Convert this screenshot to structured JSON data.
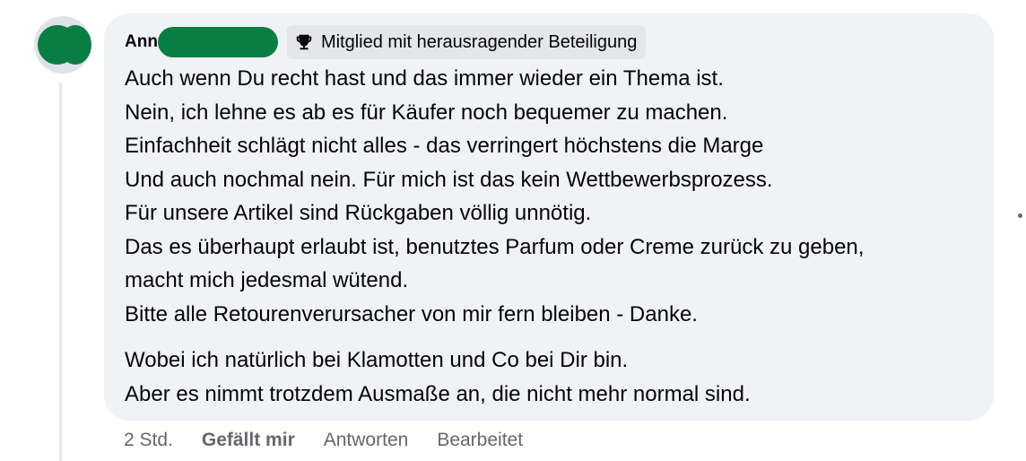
{
  "colors": {
    "redaction": "#0a7d44",
    "bubble": "#f0f2f5",
    "secondary_text": "#65676b"
  },
  "comment": {
    "author_visible": "Ann",
    "badge_icon": "trophy-icon",
    "badge": "Mitglied mit herausragender Beteiligung",
    "lines": [
      "Auch wenn Du recht hast und das immer wieder ein Thema ist.",
      "Nein, ich lehne es ab es für Käufer noch bequemer zu machen.",
      "Einfachheit schlägt nicht alles - das verringert höchstens die Marge",
      "Und auch nochmal nein. Für mich ist das kein Wettbewerbsprozess.",
      "Für unsere Artikel sind Rückgaben völlig unnötig.",
      "Das es überhaupt erlaubt ist, benutztes Parfum oder Creme zurück zu geben,",
      "macht mich jedesmal wütend.",
      "Bitte alle Retourenverursacher von mir fern bleiben - Danke.",
      "Wobei ich natürlich bei Klamotten und Co bei Dir bin.",
      "Aber es nimmt trotzdem Ausmaße an, die nicht mehr normal sind."
    ]
  },
  "actions": {
    "time": "2 Std.",
    "like": "Gefällt mir",
    "reply": "Antworten",
    "edited": "Bearbeitet"
  }
}
